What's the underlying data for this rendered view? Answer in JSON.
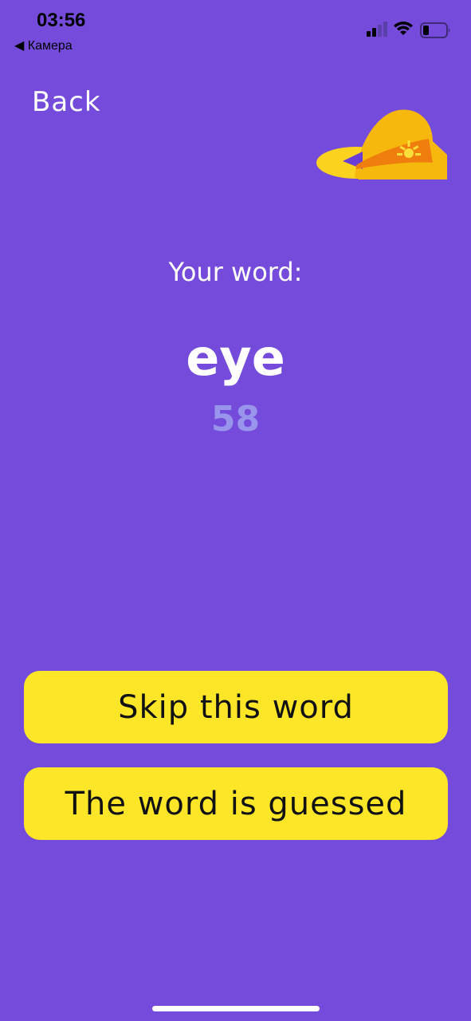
{
  "status_bar": {
    "time": "03:56",
    "back_app": "◀ Камера"
  },
  "nav": {
    "back_label": "Back"
  },
  "game": {
    "prompt_label": "Your word:",
    "word": "eye",
    "timer": "58"
  },
  "actions": {
    "skip_label": "Skip this word",
    "guessed_label": "The word is guessed"
  },
  "colors": {
    "background": "#744bdb",
    "button": "#fde628",
    "timer": "#9a95ec"
  },
  "icons": {
    "logo": "hat-icon"
  }
}
